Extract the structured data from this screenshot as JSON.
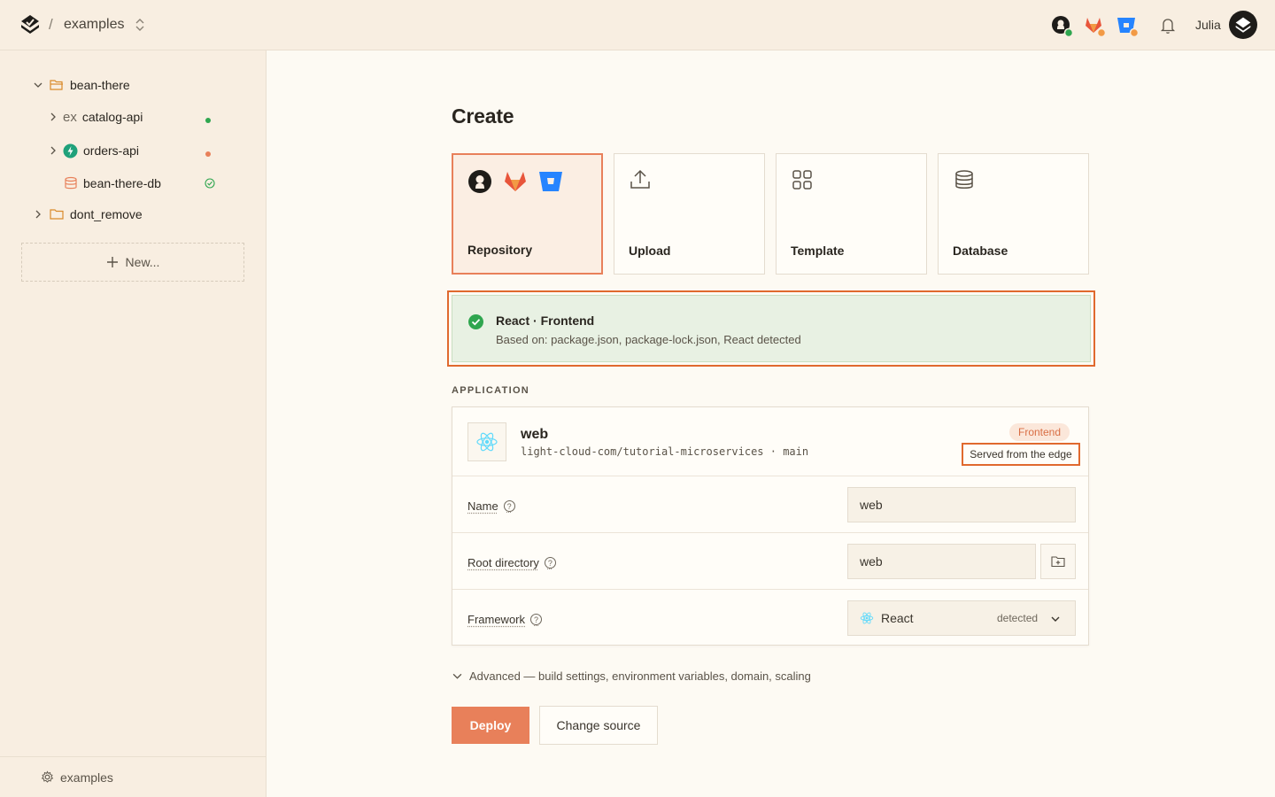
{
  "header": {
    "project": "examples",
    "user_name": "Julia"
  },
  "sidebar": {
    "items": [
      {
        "label": "bean-there",
        "kind": "folder"
      },
      {
        "label": "catalog-api",
        "kind": "service",
        "prefix": "ex",
        "status_color": "#2fa64f"
      },
      {
        "label": "orders-api",
        "kind": "service",
        "status_color": "#e8805a"
      },
      {
        "label": "bean-there-db",
        "kind": "database"
      },
      {
        "label": "dont_remove",
        "kind": "folder"
      }
    ],
    "new_label": "New...",
    "footer_label": "examples"
  },
  "main": {
    "title": "Create",
    "sources": [
      {
        "label": "Repository",
        "selected": true
      },
      {
        "label": "Upload"
      },
      {
        "label": "Template"
      },
      {
        "label": "Database"
      }
    ],
    "detection": {
      "title": "React · Frontend",
      "detail": "Based on: package.json, package-lock.json, React detected"
    },
    "section_label": "APPLICATION",
    "app": {
      "name": "web",
      "repo": "light-cloud-com/tutorial-microservices · main",
      "badge": "Frontend",
      "serving": "Served from the edge"
    },
    "fields": {
      "name": {
        "label": "Name",
        "value": "web"
      },
      "root": {
        "label": "Root directory",
        "value": "web"
      },
      "framework": {
        "label": "Framework",
        "value": "React",
        "hint": "detected"
      }
    },
    "advanced_label": "Advanced — build settings, environment variables, domain, scaling",
    "deploy_label": "Deploy",
    "change_source_label": "Change source"
  },
  "colors": {
    "accent": "#e8805a",
    "highlight": "#e0692e",
    "success": "#2fa64f",
    "react": "#61dafb"
  }
}
